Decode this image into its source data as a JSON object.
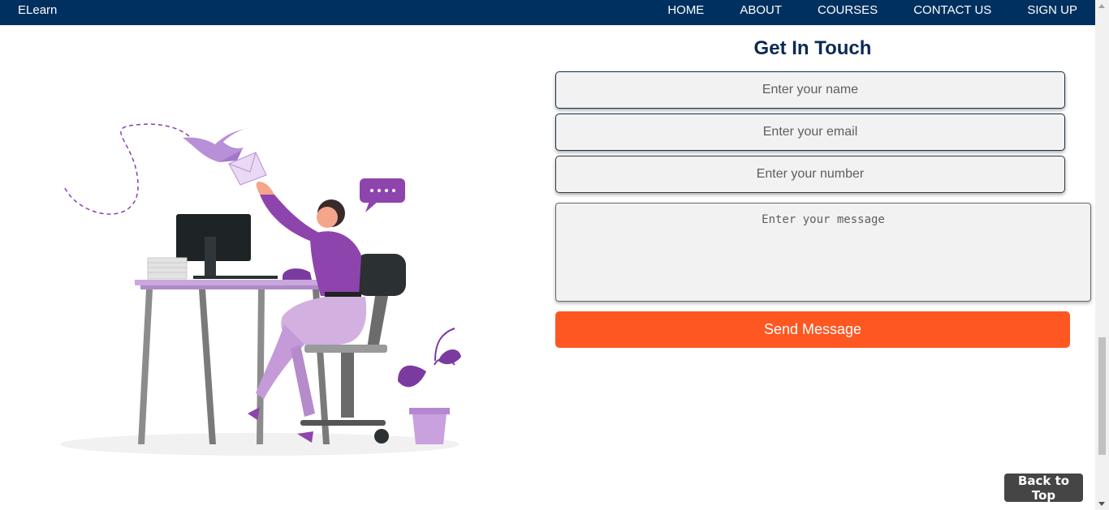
{
  "navbar": {
    "brand": "ELearn",
    "links": [
      "HOME",
      "ABOUT",
      "COURSES",
      "CONTACT US",
      "SIGN UP"
    ]
  },
  "contact": {
    "title": "Get In Touch",
    "name_placeholder": "Enter your name",
    "email_placeholder": "Enter your email",
    "number_placeholder": "Enter your number",
    "message_placeholder": "Enter your message",
    "send_label": "Send Message"
  },
  "back_to_top_label": "Back to Top",
  "colors": {
    "nav_bg": "#00305f",
    "accent": "#ff5722",
    "title": "#0a2a55",
    "illustration_purple": "#7b3aa0"
  }
}
